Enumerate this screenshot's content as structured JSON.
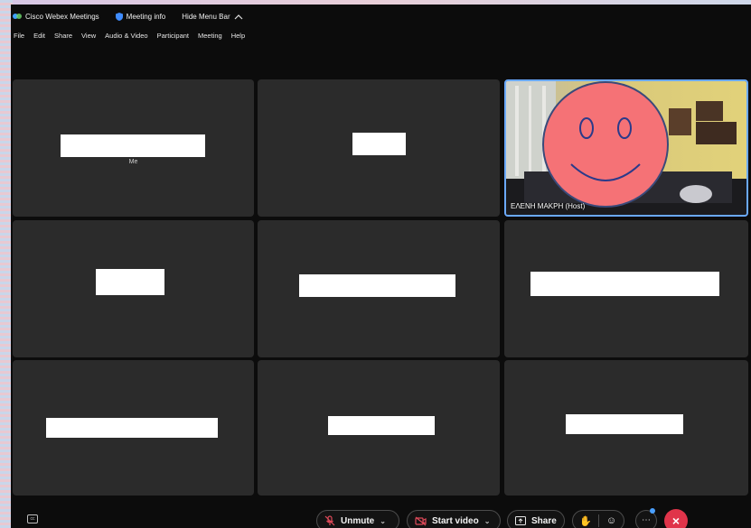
{
  "titlebar": {
    "app_name": "Cisco Webex Meetings",
    "meeting_info": "Meeting info",
    "hide_menu": "Hide Menu Bar"
  },
  "menu": {
    "items": [
      "File",
      "Edit",
      "Share",
      "View",
      "Audio & Video",
      "Participant",
      "Meeting",
      "Help"
    ]
  },
  "tiles": {
    "self_label": "Me",
    "host_name": "ΕΛΕΝΗ ΜΑΚΡΗ (Host)"
  },
  "controls": {
    "unmute": "Unmute",
    "start_video": "Start video",
    "share": "Share"
  },
  "colors": {
    "accent": "#6aa9ff",
    "end_call": "#e0344a",
    "tile_bg": "#2b2b2b",
    "unmute_icon": "#e04a5a"
  }
}
